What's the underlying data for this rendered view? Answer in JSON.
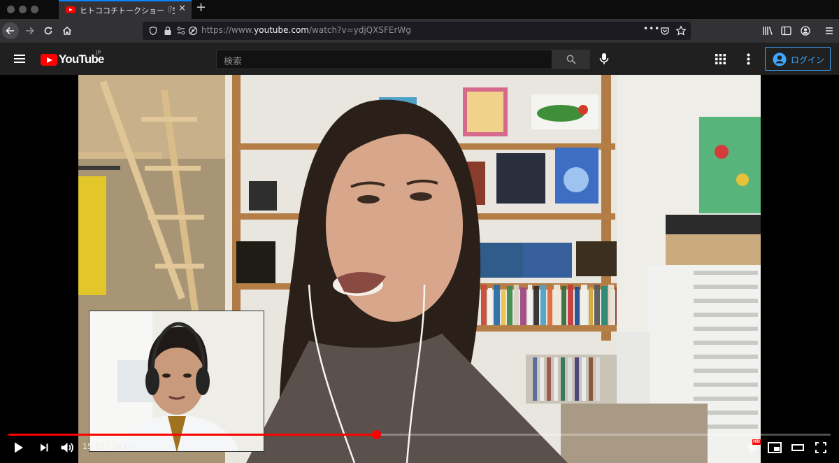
{
  "browser": {
    "tab_title": "ヒトココチトークショー『生配信",
    "tab_close": "✕",
    "new_tab": "+",
    "url_prefix": "https://www.",
    "url_domain": "youtube.com",
    "url_path": "/watch?v=ydjQXSFErWg",
    "page_actions": "•••"
  },
  "youtube": {
    "logo_text": "YouTube",
    "region": "JP",
    "search_placeholder": "検索",
    "login_label": "ログイン"
  },
  "player": {
    "current_time": "15:15",
    "duration": "34:07",
    "time_separator": " / ",
    "progress_fraction": 0.447,
    "quality_badge": "HD"
  },
  "colors": {
    "accent": "#0a84ff",
    "youtube_red": "#ff0000",
    "login_blue": "#3ea6ff"
  },
  "icons": {
    "back": "back-arrow-icon",
    "forward": "forward-arrow-icon",
    "reload": "reload-icon",
    "home": "home-icon",
    "menu": "hamburger-menu-icon",
    "search": "search-icon",
    "mic": "microphone-icon",
    "apps": "apps-grid-icon",
    "settings": "gear-icon"
  }
}
